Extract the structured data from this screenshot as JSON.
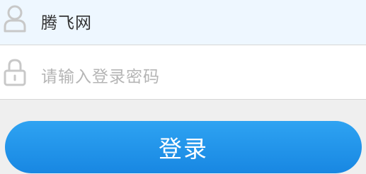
{
  "login_form": {
    "username_value": "腾飞网",
    "password_placeholder": "请输入登录密码",
    "login_button_label": "登录"
  },
  "icons": {
    "username_icon": "user-icon",
    "password_icon": "lock-icon"
  },
  "colors": {
    "username_field_bg": "#eef7ff",
    "password_field_bg": "#ffffff",
    "page_bg": "#efefef",
    "button_bg": "#1e90e8",
    "button_text": "#ffffff",
    "icon_color": "#c8c8c8",
    "placeholder_text": "#b5b5b5"
  }
}
